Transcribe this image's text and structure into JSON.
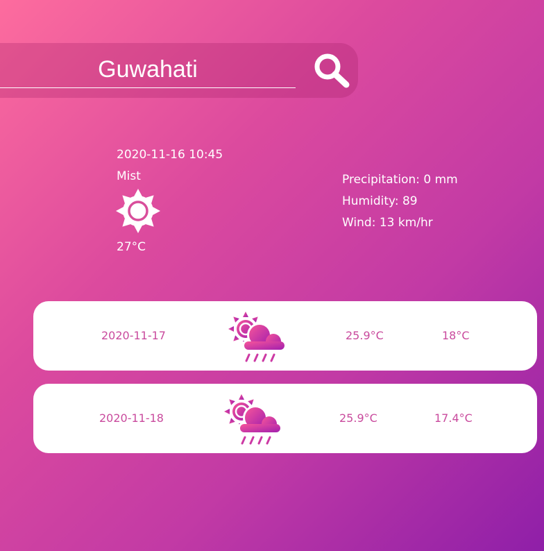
{
  "search": {
    "value": "Guwahati"
  },
  "current": {
    "datetime": "2020-11-16 10:45",
    "condition": "Mist",
    "icon": "sun-icon",
    "temperature": "27°C",
    "precipitation": "Precipitation: 0 mm",
    "humidity": "Humidity: 89",
    "wind": "Wind: 13 km/hr"
  },
  "forecast": [
    {
      "date": "2020-11-17",
      "icon": "sun-cloud-rain-icon",
      "max": "25.9°C",
      "min": "18°C"
    },
    {
      "date": "2020-11-18",
      "icon": "sun-cloud-rain-icon",
      "max": "25.9°C",
      "min": "17.4°C"
    }
  ],
  "colors": {
    "background_start": "#fd6c9e",
    "background_end": "#8f1fa8",
    "card_background": "#ffffff",
    "card_text": "#c94a9d",
    "icon_gradient_start": "#f7559a",
    "icon_gradient_end": "#a21fae"
  }
}
